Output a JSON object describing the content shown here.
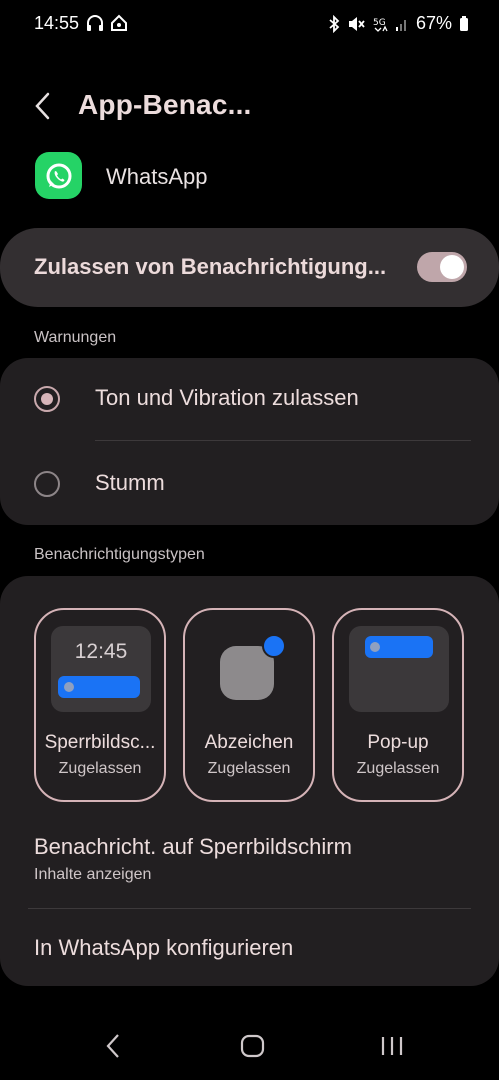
{
  "status_bar": {
    "time": "14:55",
    "battery": "67%",
    "left_icons": [
      "headphones-icon",
      "home-icon"
    ],
    "right_icons": [
      "bluetooth-icon",
      "mute-icon",
      "5g-icon",
      "signal-icon",
      "battery-icon"
    ]
  },
  "header": {
    "title": "App-Benac..."
  },
  "app": {
    "name": "WhatsApp",
    "icon": "whatsapp-icon",
    "icon_color": "#25d366"
  },
  "master_toggle": {
    "label": "Zulassen von Benachrichtigung...",
    "enabled": true
  },
  "alerts": {
    "header": "Warnungen",
    "options": [
      {
        "label": "Ton und Vibration zulassen",
        "selected": true
      },
      {
        "label": "Stumm",
        "selected": false
      }
    ]
  },
  "types": {
    "header": "Benachrichtigungstypen",
    "items": [
      {
        "name": "Sperrbildsc...",
        "status": "Zugelassen",
        "preview_time": "12:45"
      },
      {
        "name": "Abzeichen",
        "status": "Zugelassen"
      },
      {
        "name": "Pop-up",
        "status": "Zugelassen"
      }
    ],
    "lock_screen": {
      "title": "Benachricht. auf Sperrbildschirm",
      "subtitle": "Inhalte anzeigen"
    },
    "configure": {
      "title": "In WhatsApp konfigurieren"
    }
  },
  "colors": {
    "accent_blue": "#1a73f5",
    "toggle_track": "#bfa6aa",
    "tile_border": "#d5b3b7"
  }
}
